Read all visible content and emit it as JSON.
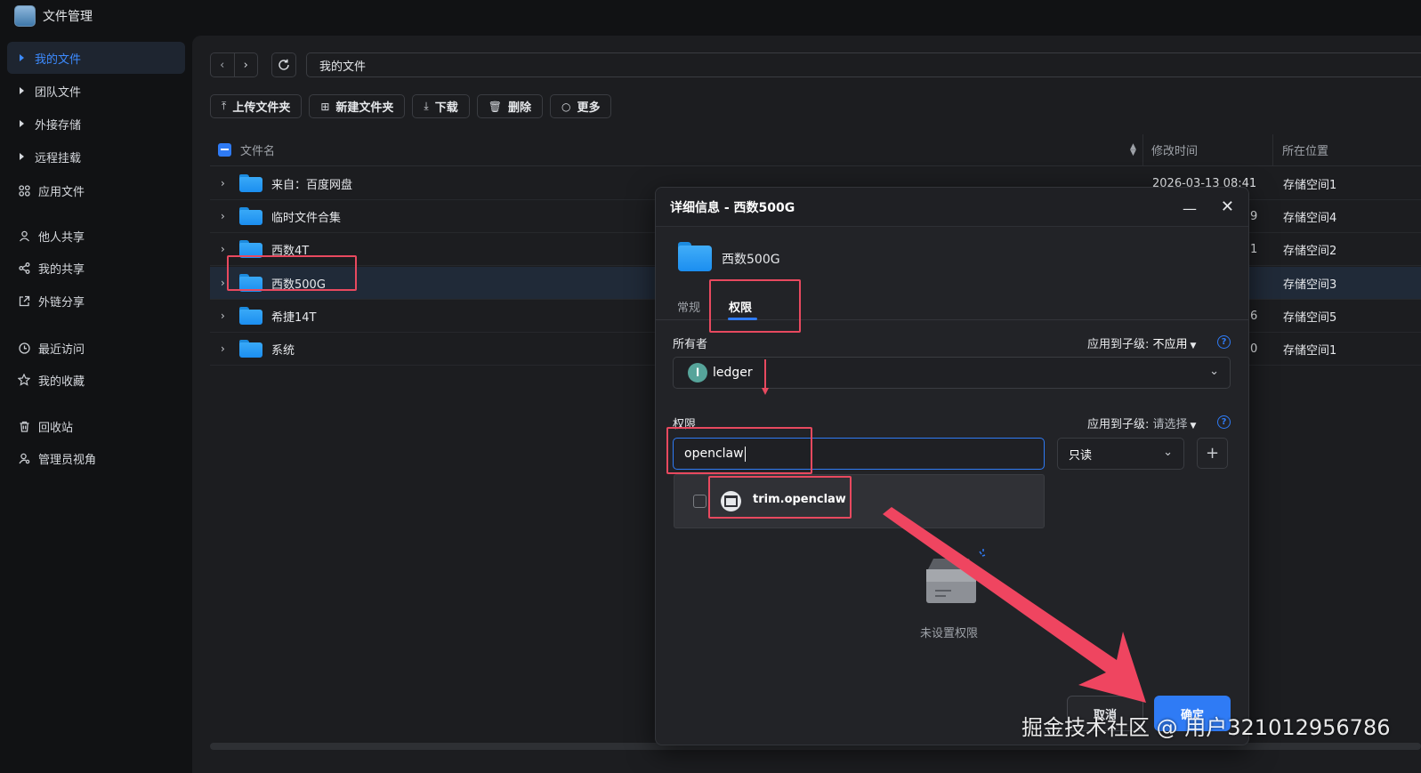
{
  "app": {
    "title": "文件管理"
  },
  "sidebar": {
    "items": [
      {
        "label": "我的文件",
        "icon": "triangle-right-icon",
        "active": true
      },
      {
        "label": "团队文件",
        "icon": "triangle-right-icon"
      },
      {
        "label": "外接存储",
        "icon": "triangle-right-icon"
      },
      {
        "label": "远程挂载",
        "icon": "triangle-right-icon"
      },
      {
        "label": "应用文件",
        "icon": "grid-icon"
      },
      {
        "label": "他人共享",
        "icon": "user-icon"
      },
      {
        "label": "我的共享",
        "icon": "share-icon"
      },
      {
        "label": "外链分享",
        "icon": "link-share-icon"
      },
      {
        "label": "最近访问",
        "icon": "clock-icon"
      },
      {
        "label": "我的收藏",
        "icon": "star-icon"
      },
      {
        "label": "回收站",
        "icon": "trash-icon"
      },
      {
        "label": "管理员视角",
        "icon": "admin-icon"
      }
    ]
  },
  "nav": {
    "back": "‹",
    "forward": "›",
    "path": "我的文件"
  },
  "toolbar": {
    "upload": "上传文件夹",
    "new_folder": "新建文件夹",
    "download": "下载",
    "delete": "删除",
    "more": "更多"
  },
  "table": {
    "headers": {
      "name": "文件名",
      "modified": "修改时间",
      "location": "所在位置"
    },
    "rows": [
      {
        "name": "来自：百度网盘",
        "time": "2026-03-13 08:41",
        "location": "存储空间1"
      },
      {
        "name": "临时文件合集",
        "time": "9",
        "location": "存储空间4"
      },
      {
        "name": "西数4T",
        "time": "1",
        "location": "存储空间2"
      },
      {
        "name": "西数500G",
        "time": "",
        "location": "存储空间3",
        "selected": true
      },
      {
        "name": "希捷14T",
        "time": "6",
        "location": "存储空间5"
      },
      {
        "name": "系统",
        "time": "0",
        "location": "存储空间1"
      }
    ]
  },
  "dialog": {
    "title": "详细信息 - 西数500G",
    "folder_name": "西数500G",
    "tabs": {
      "general": "常规",
      "permissions": "权限"
    },
    "owner": {
      "label": "所有者",
      "apply_label": "应用到子级:",
      "apply_value": "不应用",
      "avatar_letter": "l",
      "value": "ledger"
    },
    "permission": {
      "label": "权限",
      "apply_label": "应用到子级:",
      "apply_value": "请选择",
      "input_value": "openclaw",
      "access": "只读",
      "suggestion": "trim.openclaw"
    },
    "empty_text": "未设置权限",
    "cancel": "取消",
    "ok": "确定"
  },
  "watermark": "掘金技术社区 @ 用户321012956786",
  "colors": {
    "accent": "#2f7bf5",
    "highlight": "#e8495f",
    "background": "#111214",
    "panel": "#1c1d20"
  }
}
